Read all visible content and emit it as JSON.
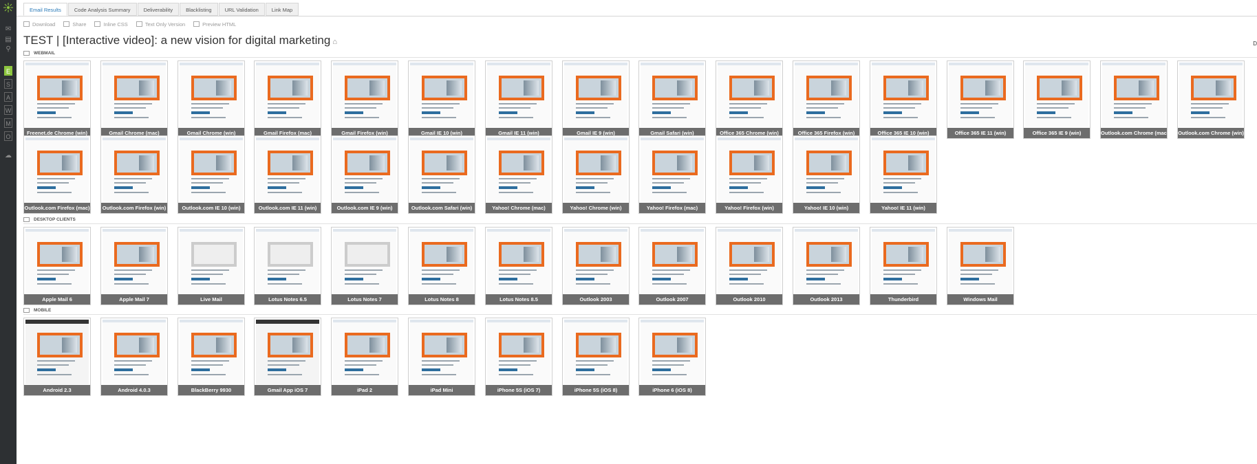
{
  "sidebar": {
    "letters": [
      "E",
      "S",
      "A",
      "W",
      "M",
      "O"
    ],
    "active_letter": "E"
  },
  "tabs": [
    "Email Results",
    "Code Analysis Summary",
    "Deliverability",
    "Blacklisting",
    "URL Validation",
    "Link Map"
  ],
  "active_tab": "Email Results",
  "toolbar": [
    "Download",
    "Share",
    "Inline CSS",
    "Text Only Version",
    "Preview HTML"
  ],
  "title": "TEST | [Interactive video]: a new vision for digital marketing",
  "right_edge_letter": "D",
  "sections": {
    "webmail": {
      "label": "WEBMAIL",
      "clients": [
        "Freenet.de Chrome (win)",
        "Gmail Chrome (mac)",
        "Gmail Chrome (win)",
        "Gmail Firefox (mac)",
        "Gmail Firefox (win)",
        "Gmail IE 10 (win)",
        "Gmail IE 11 (win)",
        "Gmail IE 9 (win)",
        "Gmail Safari (win)",
        "Office 365 Chrome (win)",
        "Office 365 Firefox (win)",
        "Office 365 IE 10 (win)",
        "Office 365 IE 11 (win)",
        "Office 365 IE 9 (win)",
        "Outlook.com Chrome (mac)",
        "Outlook.com Chrome (win)",
        "Outlook.com Firefox (mac)",
        "Outlook.com Firefox (win)",
        "Outlook.com IE 10 (win)",
        "Outlook.com IE 11 (win)",
        "Outlook.com IE 9 (win)",
        "Outlook.com Safari (win)",
        "Yahoo! Chrome (mac)",
        "Yahoo! Chrome (win)",
        "Yahoo! Firefox (mac)",
        "Yahoo! Firefox (win)",
        "Yahoo! IE 10 (win)",
        "Yahoo! IE 11 (win)"
      ]
    },
    "desktop": {
      "label": "DESKTOP CLIENTS",
      "clients": [
        "Apple Mail 6",
        "Apple Mail 7",
        "Live Mail",
        "Lotus Notes 6.5",
        "Lotus Notes 7",
        "Lotus Notes 8",
        "Lotus Notes 8.5",
        "Outlook 2003",
        "Outlook 2007",
        "Outlook 2010",
        "Outlook 2013",
        "Thunderbird",
        "Windows Mail"
      ]
    },
    "mobile": {
      "label": "MOBILE",
      "clients": [
        "Android 2.3",
        "Android 4.0.3",
        "BlackBerry 9930",
        "Gmail App iOS 7",
        "iPad 2",
        "iPad Mini",
        "iPhone 5S (iOS 7)",
        "iPhone 5S (iOS 8)",
        "iPhone 6 (iOS 8)"
      ]
    }
  }
}
